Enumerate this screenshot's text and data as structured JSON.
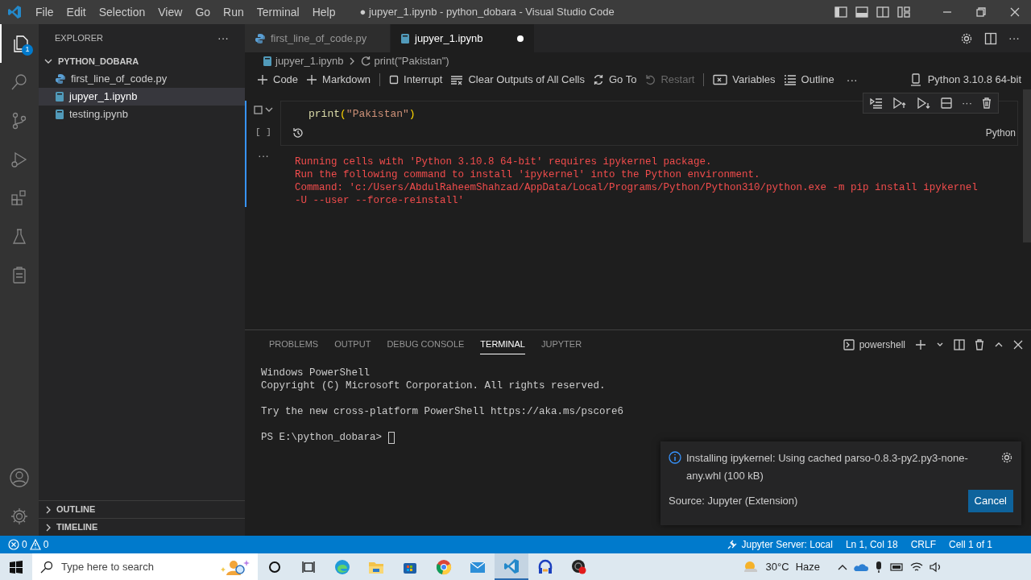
{
  "title_bar": {
    "menu": [
      "File",
      "Edit",
      "Selection",
      "View",
      "Go",
      "Run",
      "Terminal",
      "Help"
    ],
    "title": "● jupyer_1.ipynb - python_dobara - Visual Studio Code"
  },
  "activity_bar": {
    "badge": "1"
  },
  "sidebar": {
    "title": "EXPLORER",
    "more": "···",
    "folder": {
      "name": "PYTHON_DOBARA",
      "expanded": true
    },
    "files": [
      {
        "name": "first_line_of_code.py",
        "kind": "python",
        "selected": false
      },
      {
        "name": "jupyer_1.ipynb",
        "kind": "notebook",
        "selected": true
      },
      {
        "name": "testing.ipynb",
        "kind": "notebook",
        "selected": false
      }
    ],
    "sections": [
      {
        "name": "OUTLINE",
        "expanded": false
      },
      {
        "name": "TIMELINE",
        "expanded": false
      }
    ]
  },
  "tabs": [
    {
      "label": "first_line_of_code.py",
      "kind": "python",
      "selected": false,
      "modified": false
    },
    {
      "label": "jupyer_1.ipynb",
      "kind": "notebook",
      "selected": true,
      "modified": true
    }
  ],
  "editor_actions_more": "···",
  "breadcrumb": [
    "jupyer_1.ipynb",
    "print(\"Pakistan\")"
  ],
  "notebook_toolbar": {
    "items": [
      {
        "label": "Code",
        "kind": "plus",
        "disabled": false
      },
      {
        "label": "Markdown",
        "kind": "plus",
        "disabled": false
      },
      {
        "kind": "separator"
      },
      {
        "label": "Interrupt",
        "kind": "stop",
        "disabled": false
      },
      {
        "label": "Clear Outputs of All Cells",
        "kind": "clear",
        "disabled": false
      },
      {
        "label": "Go To",
        "kind": "goto",
        "disabled": false
      },
      {
        "label": "Restart",
        "kind": "restart",
        "disabled": true
      },
      {
        "kind": "separator"
      },
      {
        "label": "Variables",
        "kind": "variables",
        "disabled": false
      },
      {
        "label": "Outline",
        "kind": "outline",
        "disabled": false
      },
      {
        "label": "···",
        "kind": "more"
      }
    ],
    "kernel": "Python 3.10.8 64-bit"
  },
  "cell": {
    "code": [
      {
        "text": "print",
        "kind": "function"
      },
      {
        "text": "(",
        "kind": "bracket"
      },
      {
        "text": "\"Pakistan\"",
        "kind": "string"
      },
      {
        "text": ")",
        "kind": "bracket"
      }
    ],
    "execution": "[ ]",
    "language": "Python",
    "output_menu": "···",
    "toolbar_more": "···",
    "output": [
      "Running cells with 'Python 3.10.8 64-bit' requires ipykernel package.",
      "Run the following command to install 'ipykernel' into the Python environment.",
      "Command: 'c:/Users/AbdulRaheemShahzad/AppData/Local/Programs/Python/Python310/python.exe -m pip install ipykernel",
      "-U --user --force-reinstall'"
    ]
  },
  "panel": {
    "tabs": [
      {
        "label": "PROBLEMS",
        "selected": false
      },
      {
        "label": "OUTPUT",
        "selected": false
      },
      {
        "label": "DEBUG CONSOLE",
        "selected": false
      },
      {
        "label": "TERMINAL",
        "selected": true
      },
      {
        "label": "JUPYTER",
        "selected": false
      }
    ],
    "shell": "powershell",
    "terminal_blocks": [
      [
        "Windows PowerShell",
        "Copyright (C) Microsoft Corporation. All rights reserved."
      ],
      [
        "Try the new cross-platform PowerShell https://aka.ms/pscore6"
      ]
    ],
    "prompt": "PS E:\\python_dobara>"
  },
  "notification": {
    "message": "Installing ipykernel: Using cached parso-0.8.3-py2.py3-none-any.whl (100 kB)",
    "source": "Source: Jupyter (Extension)",
    "button": "Cancel"
  },
  "status_bar": {
    "errors": "0",
    "warnings": "0",
    "items": [
      "Jupyter Server: Local",
      "Ln 1, Col 18",
      "CRLF",
      "Cell 1 of 1"
    ]
  },
  "taskbar": {
    "search_placeholder": "Type here to search",
    "temperature": "30°C",
    "weather": "Haze"
  }
}
